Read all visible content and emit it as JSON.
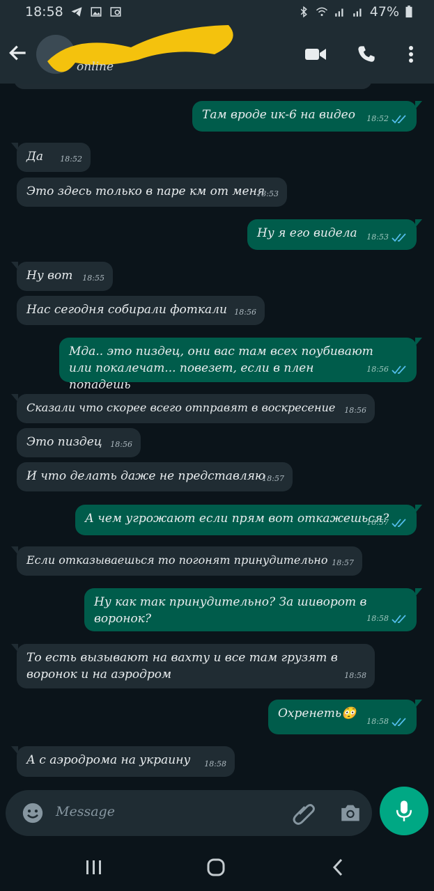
{
  "status_bar": {
    "time": "18:58",
    "battery": "47%"
  },
  "header": {
    "status": "online"
  },
  "messages": [
    {
      "dir": "in",
      "text": "",
      "time": ""
    },
    {
      "dir": "out",
      "text": "Там вроде ик-6 на видео",
      "time": "18:52"
    },
    {
      "dir": "in",
      "text": "Да",
      "time": "18:52"
    },
    {
      "dir": "in",
      "text": "Это здесь только в паре км от меня",
      "time": "18:53"
    },
    {
      "dir": "out",
      "text": "Ну я его видела",
      "time": "18:53"
    },
    {
      "dir": "in",
      "text": "Ну вот",
      "time": "18:55"
    },
    {
      "dir": "in",
      "text": "Нас сегодня собирали фоткали",
      "time": "18:56"
    },
    {
      "dir": "out",
      "text": "Мда.. это пиздец, они вас там всех поубивают или покалечат... повезет, если в плен попадешь",
      "time": "18:56"
    },
    {
      "dir": "in",
      "text": "Сказали что скорее всего отправят в воскресение",
      "time": "18:56"
    },
    {
      "dir": "in",
      "text": "Это пиздец",
      "time": "18:56"
    },
    {
      "dir": "in",
      "text": "И что делать даже не представляю",
      "time": "18:57"
    },
    {
      "dir": "out",
      "text": "А чем угрожают если прям вот откажешься?",
      "time": "18:57"
    },
    {
      "dir": "in",
      "text": "Если отказываешься то погонят принудительно",
      "time": "18:57"
    },
    {
      "dir": "out",
      "text": "Ну как так принудительно? За шиворот в воронок?",
      "time": "18:58"
    },
    {
      "dir": "in",
      "text": "То есть вызывают на вахту и все там грузят в воронок и на аэродром",
      "time": "18:58"
    },
    {
      "dir": "out",
      "text": "Охренеть😳",
      "time": "18:58"
    },
    {
      "dir": "in",
      "text": "А с аэродрома на украину",
      "time": "18:58"
    }
  ],
  "composer": {
    "placeholder": "Message"
  },
  "colors": {
    "accent": "#00a884",
    "outgoing": "#005c4b",
    "incoming": "#202c33",
    "read_ticks": "#53bdeb"
  }
}
